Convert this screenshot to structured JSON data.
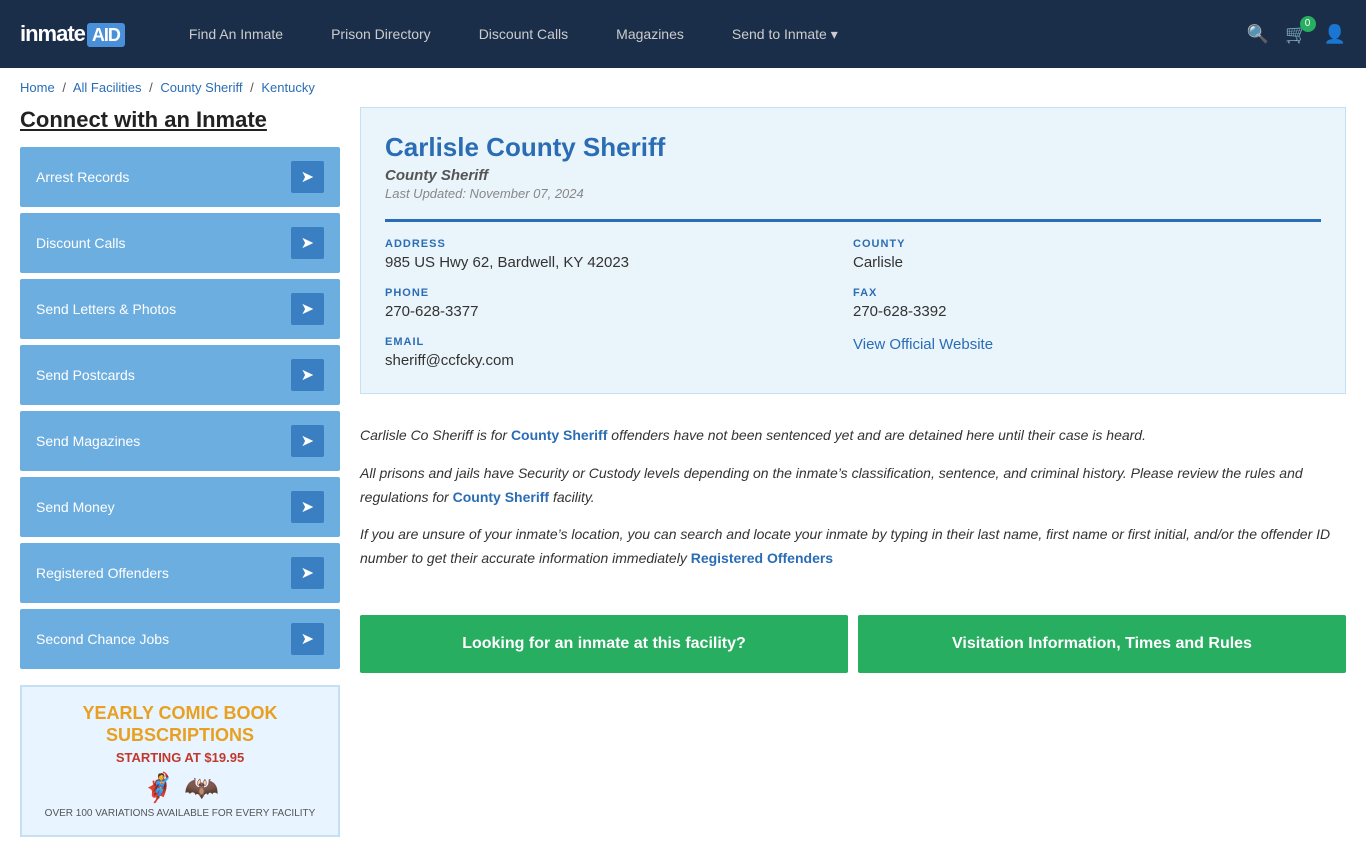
{
  "header": {
    "logo_inmate": "inmate",
    "logo_aid": "AID",
    "nav": [
      {
        "label": "Find An Inmate",
        "id": "find-inmate"
      },
      {
        "label": "Prison Directory",
        "id": "prison-directory"
      },
      {
        "label": "Discount Calls",
        "id": "discount-calls"
      },
      {
        "label": "Magazines",
        "id": "magazines"
      },
      {
        "label": "Send to Inmate ▾",
        "id": "send-to-inmate"
      }
    ],
    "cart_count": "0"
  },
  "breadcrumb": {
    "home": "Home",
    "all_facilities": "All Facilities",
    "county_sheriff": "County Sheriff",
    "state": "Kentucky"
  },
  "sidebar": {
    "title": "Connect with an Inmate",
    "items": [
      {
        "label": "Arrest Records"
      },
      {
        "label": "Discount Calls"
      },
      {
        "label": "Send Letters & Photos"
      },
      {
        "label": "Send Postcards"
      },
      {
        "label": "Send Magazines"
      },
      {
        "label": "Send Money"
      },
      {
        "label": "Registered Offenders"
      },
      {
        "label": "Second Chance Jobs"
      }
    ],
    "ad": {
      "title": "YEARLY COMIC BOOK\nSUBSCRIPTIONS",
      "subtitle": "STARTING AT $19.95",
      "small": "OVER 100 VARIATIONS AVAILABLE FOR EVERY FACILITY"
    }
  },
  "facility": {
    "name": "Carlisle County Sheriff",
    "type": "County Sheriff",
    "last_updated": "Last Updated: November 07, 2024",
    "address_label": "ADDRESS",
    "address_value": "985 US Hwy 62, Bardwell, KY 42023",
    "county_label": "COUNTY",
    "county_value": "Carlisle",
    "phone_label": "PHONE",
    "phone_value": "270-628-3377",
    "fax_label": "FAX",
    "fax_value": "270-628-3392",
    "email_label": "EMAIL",
    "email_value": "sheriff@ccfcky.com",
    "website_label": "View Official Website",
    "website_url": "#"
  },
  "description": {
    "para1_prefix": "Carlisle Co Sheriff is for ",
    "para1_link": "County Sheriff",
    "para1_suffix": " offenders have not been sentenced yet and are detained here until their case is heard.",
    "para2": "All prisons and jails have Security or Custody levels depending on the inmate’s classification, sentence, and criminal history. Please review the rules and regulations for ",
    "para2_link": "County Sheriff",
    "para2_suffix": " facility.",
    "para3": "If you are unsure of your inmate’s location, you can search and locate your inmate by typing in their last name, first name or first initial, and/or the offender ID number to get their accurate information immediately ",
    "para3_link": "Registered Offenders"
  },
  "buttons": {
    "find_inmate": "Looking for an inmate at this facility?",
    "visitation": "Visitation Information, Times and Rules"
  }
}
